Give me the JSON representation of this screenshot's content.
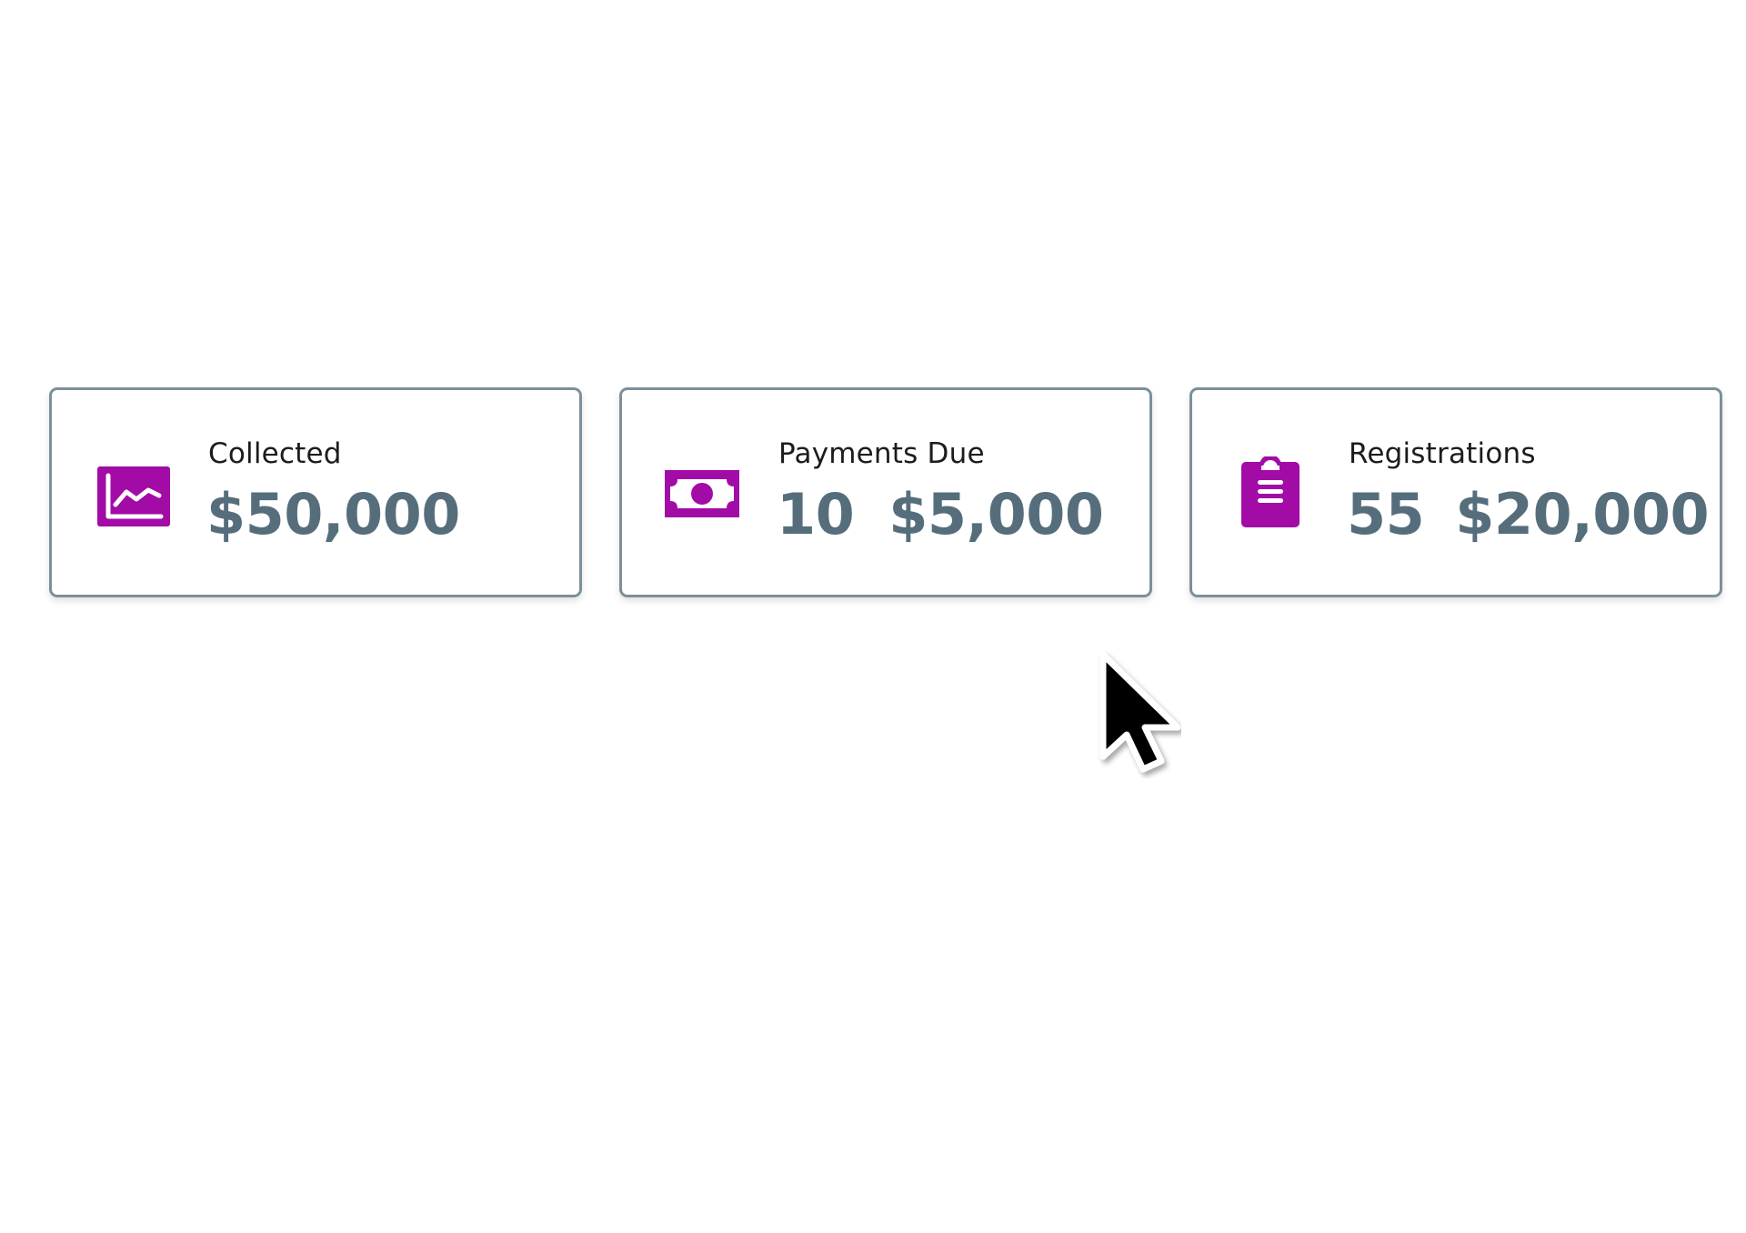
{
  "accent_color": "#a20ba6",
  "value_color": "#566e7c",
  "border_color": "#7b909c",
  "cards": [
    {
      "icon": "line-chart-icon",
      "label": "Collected",
      "value": "$50,000"
    },
    {
      "icon": "banknote-icon",
      "label": "Payments Due",
      "count": "10",
      "value": "$5,000"
    },
    {
      "icon": "clipboard-icon",
      "label": "Registrations",
      "count": "55",
      "value": "$20,000"
    }
  ],
  "cursor": "mouse-pointer-icon"
}
